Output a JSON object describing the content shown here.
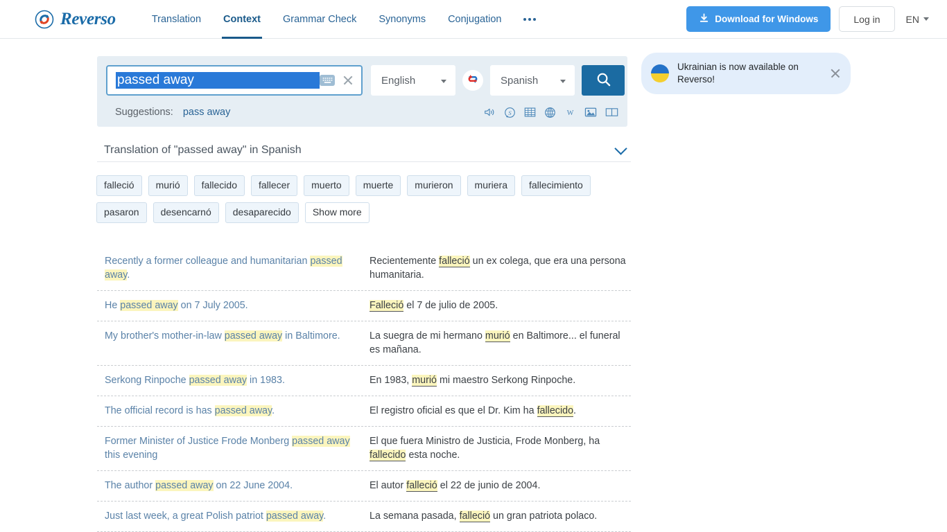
{
  "header": {
    "brand": "Reverso",
    "logo_icon": "reverso-cycle-logo",
    "nav": [
      {
        "label": "Translation",
        "active": false
      },
      {
        "label": "Context",
        "active": true
      },
      {
        "label": "Grammar Check",
        "active": false
      },
      {
        "label": "Synonyms",
        "active": false
      },
      {
        "label": "Conjugation",
        "active": false
      }
    ],
    "more_icon": "ellipsis-icon",
    "download_label": "Download for Windows",
    "download_icon": "download-icon",
    "download_color": "#3f97e8",
    "login_label": "Log in",
    "ui_language": "EN",
    "caret_icon": "chevron-down-icon"
  },
  "search": {
    "query": "passed away",
    "query_selected": true,
    "keyboard_icon": "keyboard-icon",
    "clear_icon": "close-icon",
    "source_language": "English",
    "target_language": "Spanish",
    "swap_icon": "swap-languages-icon",
    "search_icon": "search-icon",
    "search_button_color": "#1b6ba2",
    "suggestions_label": "Suggestions:",
    "suggestions": [
      "pass away"
    ],
    "tools": [
      {
        "name": "pronounce-icon",
        "glyph": "speaker"
      },
      {
        "name": "synonyms-icon",
        "glyph": "S"
      },
      {
        "name": "conjugation-icon",
        "glyph": "table"
      },
      {
        "name": "web-icon",
        "glyph": "globe"
      },
      {
        "name": "wikipedia-icon",
        "glyph": "W"
      },
      {
        "name": "images-icon",
        "glyph": "image"
      },
      {
        "name": "dictionary-icon",
        "glyph": "book"
      }
    ]
  },
  "notification": {
    "flag_icon": "ukraine-flag-icon",
    "message": "Ukrainian is now available on Reverso!",
    "close_icon": "close-icon",
    "background": "#e3eefb"
  },
  "translation_section": {
    "title": "Translation of \"passed away\" in Spanish",
    "toggle_icon": "chevron-down-icon",
    "tags": [
      "falleció",
      "murió",
      "fallecido",
      "fallecer",
      "muerto",
      "muerte",
      "murieron",
      "muriera",
      "fallecimiento",
      "pasaron",
      "desencarnó",
      "desaparecido"
    ],
    "show_more_label": "Show more",
    "highlight_color": "#fbf5bd"
  },
  "examples": [
    {
      "source": [
        {
          "t": "Recently a former colleague and humanitarian ",
          "h": false
        },
        {
          "t": "passed away",
          "h": true
        },
        {
          "t": ".",
          "h": false
        }
      ],
      "target": [
        {
          "t": "Recientemente ",
          "h": false
        },
        {
          "t": "falleció",
          "h": true
        },
        {
          "t": " un ex colega, que era una persona humanitaria.",
          "h": false
        }
      ]
    },
    {
      "source": [
        {
          "t": "He ",
          "h": false
        },
        {
          "t": "passed away",
          "h": true
        },
        {
          "t": " on 7 July 2005.",
          "h": false
        }
      ],
      "target": [
        {
          "t": "Falleció",
          "h": true
        },
        {
          "t": " el 7 de julio de 2005.",
          "h": false
        }
      ]
    },
    {
      "source": [
        {
          "t": "My brother's mother-in-law ",
          "h": false
        },
        {
          "t": "passed away",
          "h": true
        },
        {
          "t": " in Baltimore.",
          "h": false
        }
      ],
      "target": [
        {
          "t": "La suegra de mi hermano ",
          "h": false
        },
        {
          "t": "murió",
          "h": true
        },
        {
          "t": " en Baltimore... el funeral es mañana.",
          "h": false
        }
      ]
    },
    {
      "source": [
        {
          "t": "Serkong Rinpoche ",
          "h": false
        },
        {
          "t": "passed away",
          "h": true
        },
        {
          "t": " in 1983.",
          "h": false
        }
      ],
      "target": [
        {
          "t": "En 1983, ",
          "h": false
        },
        {
          "t": "murió",
          "h": true
        },
        {
          "t": " mi maestro Serkong Rinpoche.",
          "h": false
        }
      ]
    },
    {
      "source": [
        {
          "t": "The official record is has ",
          "h": false
        },
        {
          "t": "passed away",
          "h": true
        },
        {
          "t": ".",
          "h": false
        }
      ],
      "target": [
        {
          "t": "El registro oficial es que el Dr. Kim ha ",
          "h": false
        },
        {
          "t": "fallecido",
          "h": true
        },
        {
          "t": ".",
          "h": false
        }
      ]
    },
    {
      "source": [
        {
          "t": "Former Minister of Justice Frode Monberg ",
          "h": false
        },
        {
          "t": "passed away",
          "h": true
        },
        {
          "t": " this evening",
          "h": false
        }
      ],
      "target": [
        {
          "t": "El que fuera Ministro de Justicia, Frode Monberg, ha ",
          "h": false
        },
        {
          "t": "fallecido",
          "h": true
        },
        {
          "t": " esta noche.",
          "h": false
        }
      ]
    },
    {
      "source": [
        {
          "t": "The author ",
          "h": false
        },
        {
          "t": "passed away",
          "h": true
        },
        {
          "t": " on 22 June 2004.",
          "h": false
        }
      ],
      "target": [
        {
          "t": "El autor ",
          "h": false
        },
        {
          "t": "falleció",
          "h": true
        },
        {
          "t": " el 22 de junio de 2004.",
          "h": false
        }
      ]
    },
    {
      "source": [
        {
          "t": "Just last week, a great Polish patriot ",
          "h": false
        },
        {
          "t": "passed away",
          "h": true
        },
        {
          "t": ".",
          "h": false
        }
      ],
      "target": [
        {
          "t": "La semana pasada, ",
          "h": false
        },
        {
          "t": "falleció",
          "h": true
        },
        {
          "t": " un gran patriota polaco.",
          "h": false
        }
      ]
    }
  ]
}
